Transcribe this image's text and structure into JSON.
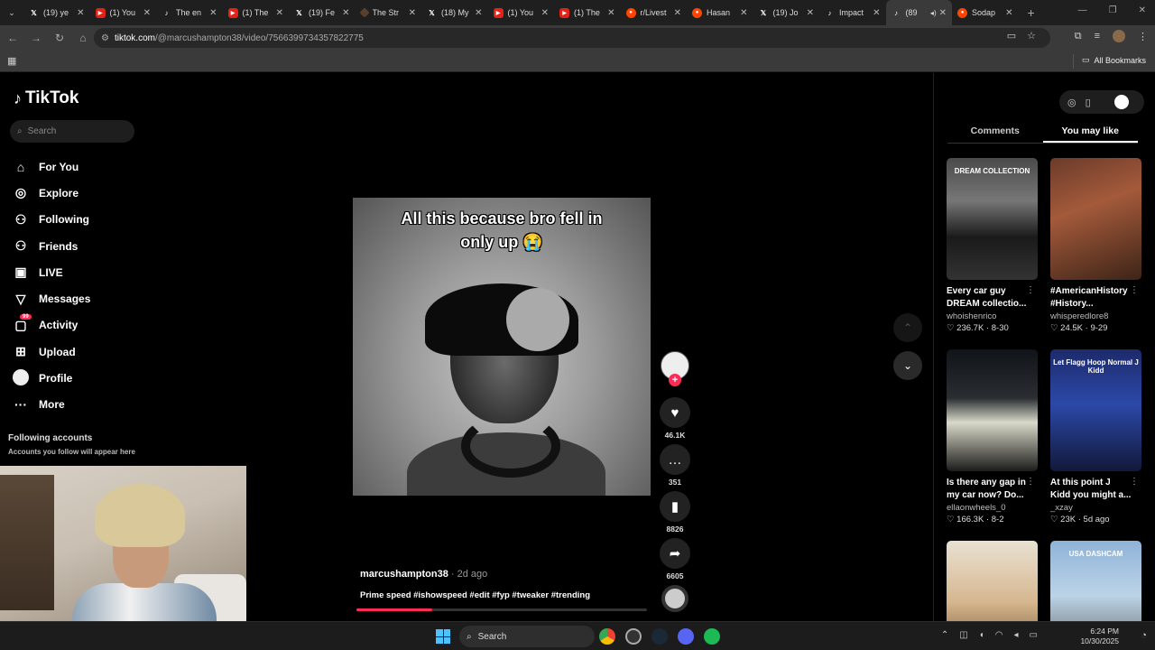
{
  "browser": {
    "tabs": [
      {
        "title": "(19) ye",
        "icon": "x-icon"
      },
      {
        "title": "(1) You",
        "icon": "youtube-icon"
      },
      {
        "title": "The en",
        "icon": "tiktok-icon"
      },
      {
        "title": "(1) The",
        "icon": "youtube-icon"
      },
      {
        "title": "(19) Fe",
        "icon": "x-icon"
      },
      {
        "title": "The Str",
        "icon": "strat-icon"
      },
      {
        "title": "(18) My",
        "icon": "x-icon"
      },
      {
        "title": "(1) You",
        "icon": "youtube-icon"
      },
      {
        "title": "(1) The",
        "icon": "youtube-icon"
      },
      {
        "title": "r/Livest",
        "icon": "reddit-icon"
      },
      {
        "title": "Hasan",
        "icon": "reddit-icon"
      },
      {
        "title": "(19) Jo",
        "icon": "x-icon"
      },
      {
        "title": "Impact",
        "icon": "tiktok-icon"
      },
      {
        "title": "(89",
        "icon": "tiktok-icon",
        "active": true
      },
      {
        "title": "Sodap",
        "icon": "reddit-icon"
      }
    ],
    "url_host": "tiktok.com",
    "url_path": "/@marcushampton38/video/7566399734357822775",
    "bookmarks_all": "All Bookmarks"
  },
  "sidebar": {
    "logo": "TikTok",
    "search_placeholder": "Search",
    "nav": [
      {
        "label": "For You",
        "icon": "home-icon"
      },
      {
        "label": "Explore",
        "icon": "compass-icon"
      },
      {
        "label": "Following",
        "icon": "following-icon"
      },
      {
        "label": "Friends",
        "icon": "friends-icon"
      },
      {
        "label": "LIVE",
        "icon": "live-icon"
      },
      {
        "label": "Messages",
        "icon": "messages-icon"
      },
      {
        "label": "Activity",
        "icon": "activity-icon",
        "badge": "99"
      },
      {
        "label": "Upload",
        "icon": "upload-icon"
      },
      {
        "label": "Profile",
        "icon": "profile-icon"
      },
      {
        "label": "More",
        "icon": "more-icon"
      }
    ],
    "following_heading": "Following accounts",
    "following_sub": "Accounts you follow will appear here"
  },
  "video": {
    "caption_line1": "All this because bro fell in",
    "caption_line2": "only up 😭",
    "author": "marcushampton38",
    "time": "· 2d ago",
    "description": "Prime speed #ishowspeed #edit #fyp #tweaker #trending",
    "progress": 0.26,
    "likes": "46.1K",
    "comments": "351",
    "saves": "8826",
    "shares": "6605"
  },
  "right_panel": {
    "tab_comments": "Comments",
    "tab_you_may_like": "You may like",
    "cards": [
      {
        "title": "Every car guy DREAM collectio...",
        "user": "whoishenrico",
        "likes": "236.7K",
        "date": "8-30",
        "overlay": "DREAM COLLECTION"
      },
      {
        "title": "#AmericanHistory #History...",
        "user": "whisperedlore8",
        "likes": "24.5K",
        "date": "9-29",
        "overlay": ""
      },
      {
        "title": "Is there any gap in my car now? Do...",
        "user": "ellaonwheels_0",
        "likes": "166.3K",
        "date": "8-2",
        "overlay": ""
      },
      {
        "title": "At this point J Kidd you might a...",
        "user": "_xzay",
        "likes": "23K",
        "date": "5d ago",
        "overlay": "Let Flagg Hoop Normal J Kidd"
      },
      {
        "title": "",
        "user": "",
        "likes": "",
        "date": "",
        "overlay": ""
      },
      {
        "title": "",
        "user": "",
        "likes": "",
        "date": "",
        "overlay": "USA DASHCAM"
      }
    ]
  },
  "taskbar": {
    "search": "Search",
    "time": "6:24 PM",
    "date": "10/30/2025"
  },
  "colors": {
    "accent": "#fe2c55",
    "background": "#000000"
  }
}
